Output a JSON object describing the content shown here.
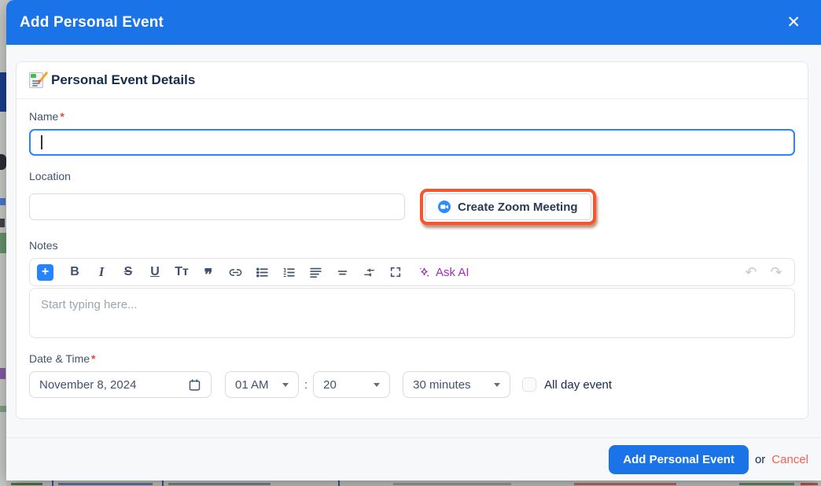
{
  "modal": {
    "title": "Add Personal Event",
    "close_icon": "✕"
  },
  "card": {
    "icon": "memo-icon",
    "title": "Personal Event Details"
  },
  "fields": {
    "name": {
      "label": "Name",
      "required": "*",
      "value": ""
    },
    "location": {
      "label": "Location",
      "value": ""
    },
    "zoom_button": {
      "icon": "zoom-camera-icon",
      "label": "Create Zoom Meeting"
    },
    "notes": {
      "label": "Notes",
      "placeholder": "Start typing here...",
      "toolbar": {
        "insert_plus": "+",
        "bold": "B",
        "italic": "I",
        "strikethrough": "S",
        "underline": "U",
        "text_format": "Tᴛ",
        "quote": "❞",
        "ask_ai": "Ask AI",
        "undo": "↶",
        "redo": "↷"
      }
    },
    "datetime": {
      "label": "Date & Time",
      "required": "*",
      "date_value": "November 8, 2024",
      "hour_value": "01 AM",
      "separator": ":",
      "minute_value": "20",
      "duration_value": "30 minutes",
      "all_day_label": "All day event"
    }
  },
  "footer": {
    "submit_label": "Add Personal Event",
    "or_text": "or",
    "cancel_label": "Cancel"
  },
  "colors": {
    "header_blue": "#1b73e8",
    "focus_blue": "#2684ff",
    "highlight_orange": "#f4572e",
    "ask_ai_purple": "#a02db5",
    "cancel_red": "#f4614d",
    "required_red": "#e34935"
  }
}
